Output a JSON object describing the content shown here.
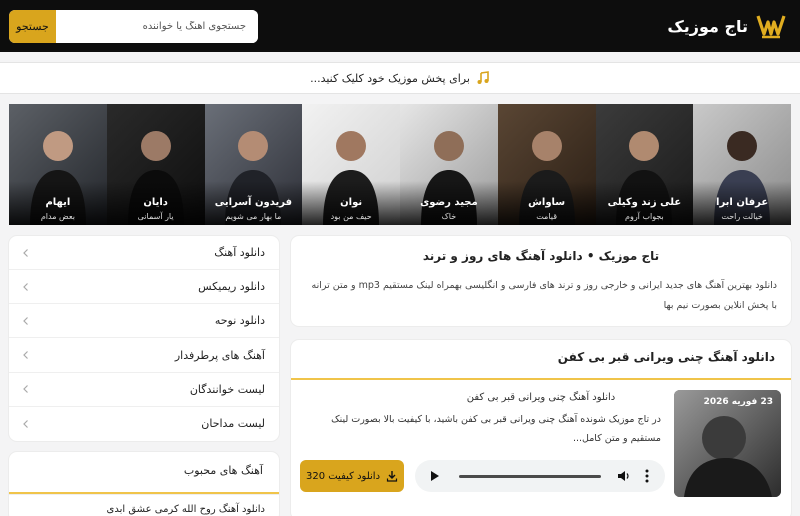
{
  "brand": {
    "name": "تاج موزیک",
    "accent": "#d9a51d"
  },
  "search": {
    "placeholder": "جستجوی آهنگ یا خواننده",
    "button_label": "جستجو"
  },
  "player_bar": {
    "text": "برای پخش موزیک خود کلیک کنید..."
  },
  "artists": [
    {
      "name": "عرفان ابرا",
      "song": "خیالت راحت"
    },
    {
      "name": "علی زند وکیلی",
      "song": "بجواب آروم"
    },
    {
      "name": "ساواش",
      "song": "قیامت"
    },
    {
      "name": "مجید رضوی",
      "song": "خاک"
    },
    {
      "name": "نوان",
      "song": "حیف من بود"
    },
    {
      "name": "فریدون آسرایی",
      "song": "ما بهار می شویم"
    },
    {
      "name": "دایان",
      "song": "یار آسمانی"
    },
    {
      "name": "ایهام",
      "song": "بعض مدام"
    }
  ],
  "sidebar": {
    "menu": [
      {
        "label": "دانلود آهنگ"
      },
      {
        "label": "دانلود ریمیکس"
      },
      {
        "label": "دانلود نوحه"
      },
      {
        "label": "آهنگ های پرطرفدار"
      },
      {
        "label": "لیست خوانندگان"
      },
      {
        "label": "لیست مداحان"
      }
    ],
    "favorites": {
      "title": "آهنگ های محبوب",
      "items": [
        "دانلود آهنگ روح الله کرمی عشق ابدی"
      ]
    }
  },
  "intro": {
    "title": "تاج موزیک • دانلود آهنگ های روز و ترند",
    "description": "دانلود بهترین آهنگ های جدید ایرانی و خارجی روز و ترند های فارسی و انگلیسی بهمراه لینک مستقیم mp3 و متن ترانه با پخش انلاین بصورت نیم بها"
  },
  "post": {
    "title": "دانلود آهنگ چنی ویرانی قبر بی کفن",
    "date": "23 فوریه 2026",
    "subtitle": "دانلود آهنگ چنی ویرانی قبر بی کفن",
    "excerpt": "در تاج موزیک شونده آهنگ چنی ویرانی قبر بی کفن باشید، با کیفیت بالا بصورت لینک مستقیم و متن کامل...",
    "download_label": "دانلود کیفیت 320"
  }
}
